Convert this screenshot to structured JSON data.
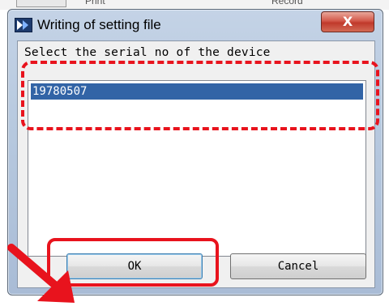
{
  "background": {
    "mid_text": "Print",
    "right_text": "Record"
  },
  "dialog": {
    "title": "Writing of setting file",
    "close_glyph": "X",
    "prompt": "Select the serial no of the device",
    "devices": [
      "19780507"
    ],
    "selected_device": "19780507",
    "ok_label": "OK",
    "cancel_label": "Cancel"
  },
  "annotations": {
    "color": "#e8131d",
    "icon_names": [
      "dashed-highlight",
      "solid-highlight",
      "arrow-icon"
    ]
  },
  "colors": {
    "selection": "#3264a6",
    "title_bar": "#b7c9df",
    "close_button": "#c0392b"
  }
}
